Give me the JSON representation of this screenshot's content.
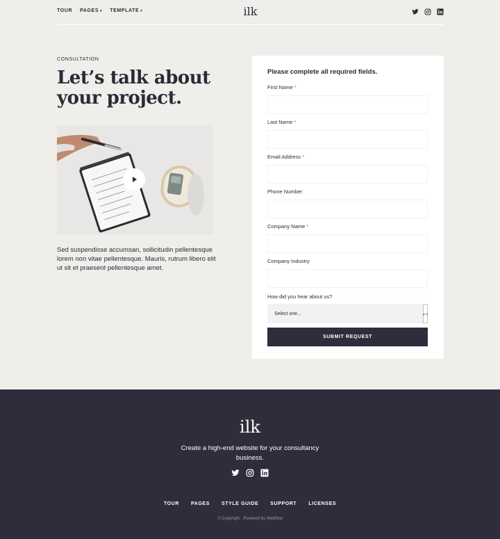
{
  "nav": {
    "links": [
      {
        "label": "TOUR",
        "has_caret": false
      },
      {
        "label": "PAGES",
        "has_caret": true
      },
      {
        "label": "TEMPLATE",
        "has_caret": true
      }
    ],
    "caret": "▾",
    "logo": "ilk",
    "social_icons": [
      "twitter-icon",
      "instagram-icon",
      "linkedin-icon"
    ]
  },
  "hero": {
    "eyebrow": "CONSULTATION",
    "headline": "Let’s talk about your project.",
    "body": "Sed suspendisse accumsan, sollicitudin pellentesque lorem non vitae pellentesque. Mauris, rutrum libero elit ut sit et praesent pellentesque amet.",
    "media_icon": "play-icon"
  },
  "form": {
    "title": "Please complete all required fields.",
    "required_marker": "*",
    "fields": [
      {
        "label": "First Name",
        "required": true,
        "value": "",
        "placeholder": ""
      },
      {
        "label": "Last Name",
        "required": true,
        "value": "",
        "placeholder": ""
      },
      {
        "label": "Email Address",
        "required": true,
        "value": "",
        "placeholder": ""
      },
      {
        "label": "Phone Number",
        "required": false,
        "value": "",
        "placeholder": ""
      },
      {
        "label": "Company Name",
        "required": true,
        "value": "",
        "placeholder": ""
      },
      {
        "label": "Company Industry",
        "required": false,
        "value": "",
        "placeholder": ""
      }
    ],
    "source_question": "How did you hear about us?",
    "select_value": "Select one...",
    "submit_label": "SUBMIT REQUEST"
  },
  "footer": {
    "logo": "ilk",
    "tagline": "Create a high-end website for your consultancy business.",
    "social_icons": [
      "twitter-icon",
      "instagram-icon",
      "linkedin-icon"
    ],
    "links": [
      "TOUR",
      "PAGES",
      "STYLE GUIDE",
      "SUPPORT",
      "LICENSES"
    ],
    "copyright": "© Copyright · Powered by Webflow"
  },
  "colors": {
    "page_bg": "#efeeea",
    "ink": "#2b2b36",
    "footer_bg": "#2d2d3b",
    "required": "#e0524a"
  }
}
